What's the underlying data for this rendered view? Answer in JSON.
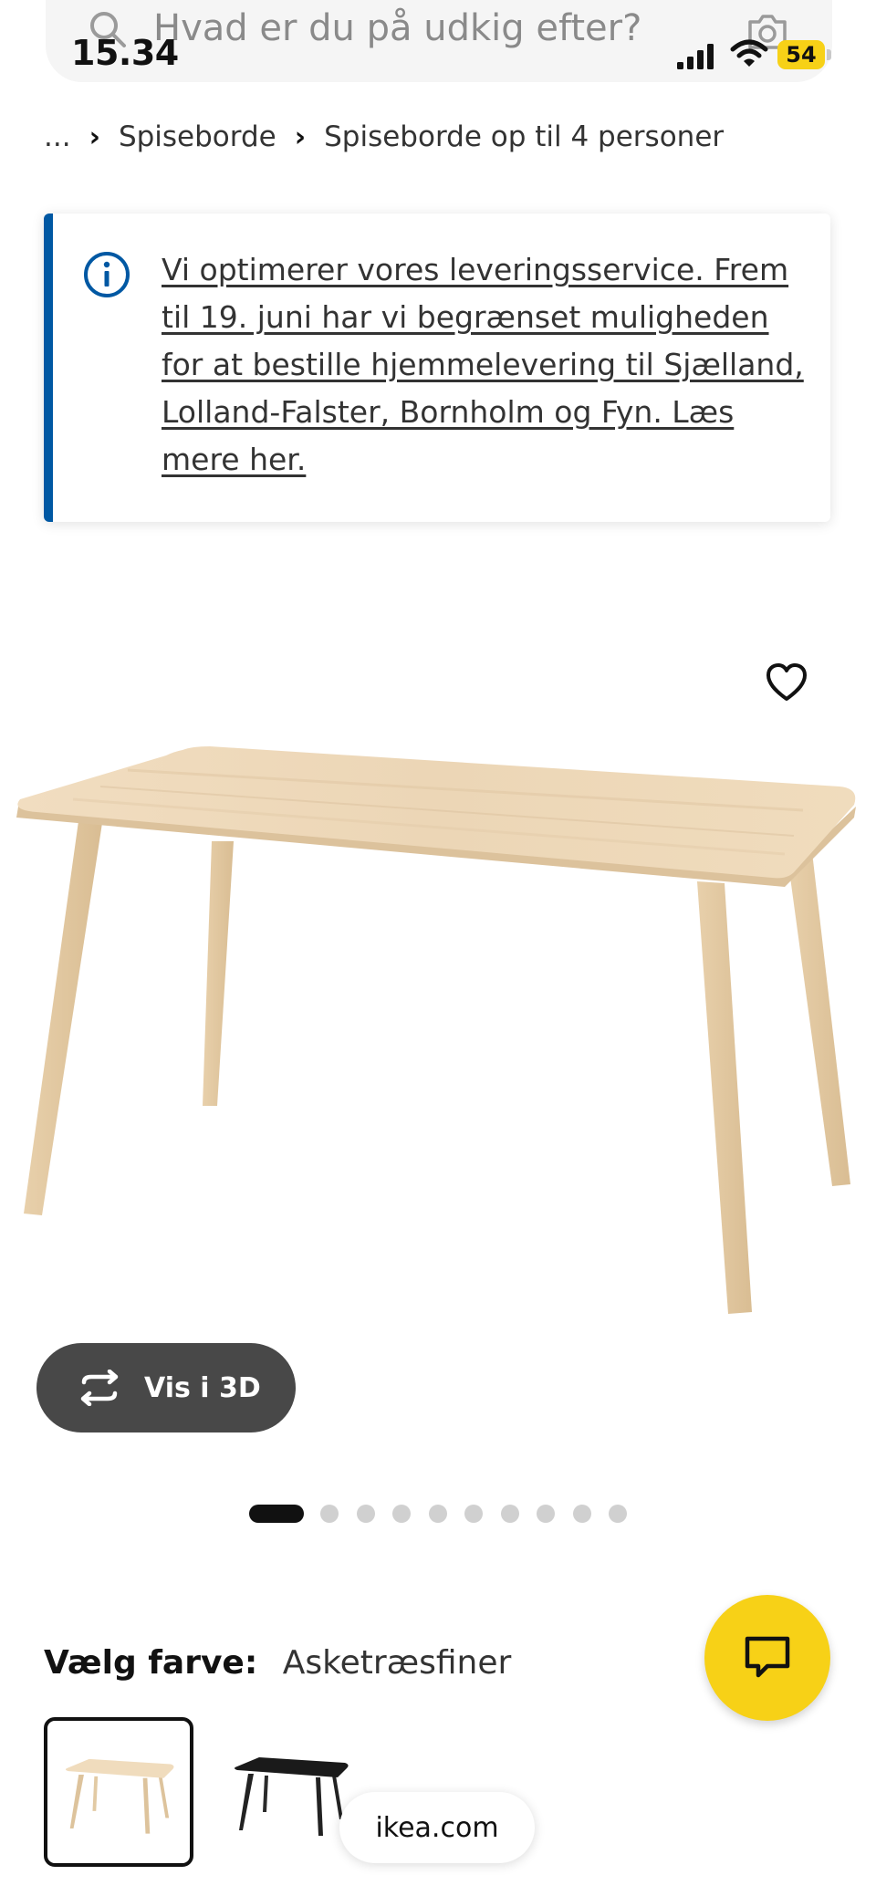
{
  "status_bar": {
    "time": "15.34",
    "battery": "54"
  },
  "search": {
    "placeholder": "Hvad er du på udkig efter?",
    "icon": "search-icon",
    "camera_icon": "camera-icon"
  },
  "breadcrumb": {
    "items": [
      "...",
      "Spiseborde",
      "Spiseborde op til 4 personer"
    ]
  },
  "banner": {
    "text": "Vi optimerer vores leveringsservice. Frem til 19. juni har vi begrænset muligheden for at bestille hjemmelevering til Sjælland, Lolland-Falster, Bornholm og Fyn. Læs mere her.",
    "accent_color": "#0058a3",
    "icon": "info-icon"
  },
  "product": {
    "favorite_icon": "heart-icon",
    "view_3d_label": "Vis i 3D",
    "carousel": {
      "total": 10,
      "active": 1
    }
  },
  "color_select": {
    "label": "Vælg farve:",
    "value": "Asketræsfiner",
    "options": [
      "Asketræsfiner",
      "black"
    ]
  },
  "chat": {
    "icon": "chat-icon",
    "color": "#f7d117"
  },
  "browser": {
    "url": "ikea.com"
  }
}
